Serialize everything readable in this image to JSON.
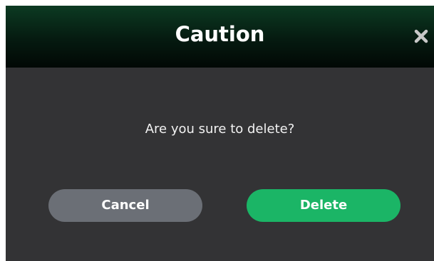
{
  "dialog": {
    "title": "Caution",
    "message": "Are you sure to delete?",
    "close_icon": "close-icon",
    "buttons": {
      "cancel_label": "Cancel",
      "delete_label": "Delete"
    }
  },
  "colors": {
    "header_top": "#0c3a22",
    "header_bottom": "#020805",
    "dialog_background": "#333335",
    "cancel_button": "#6b6f76",
    "delete_button": "#1bb566",
    "close_icon": "#c8c8c8"
  }
}
